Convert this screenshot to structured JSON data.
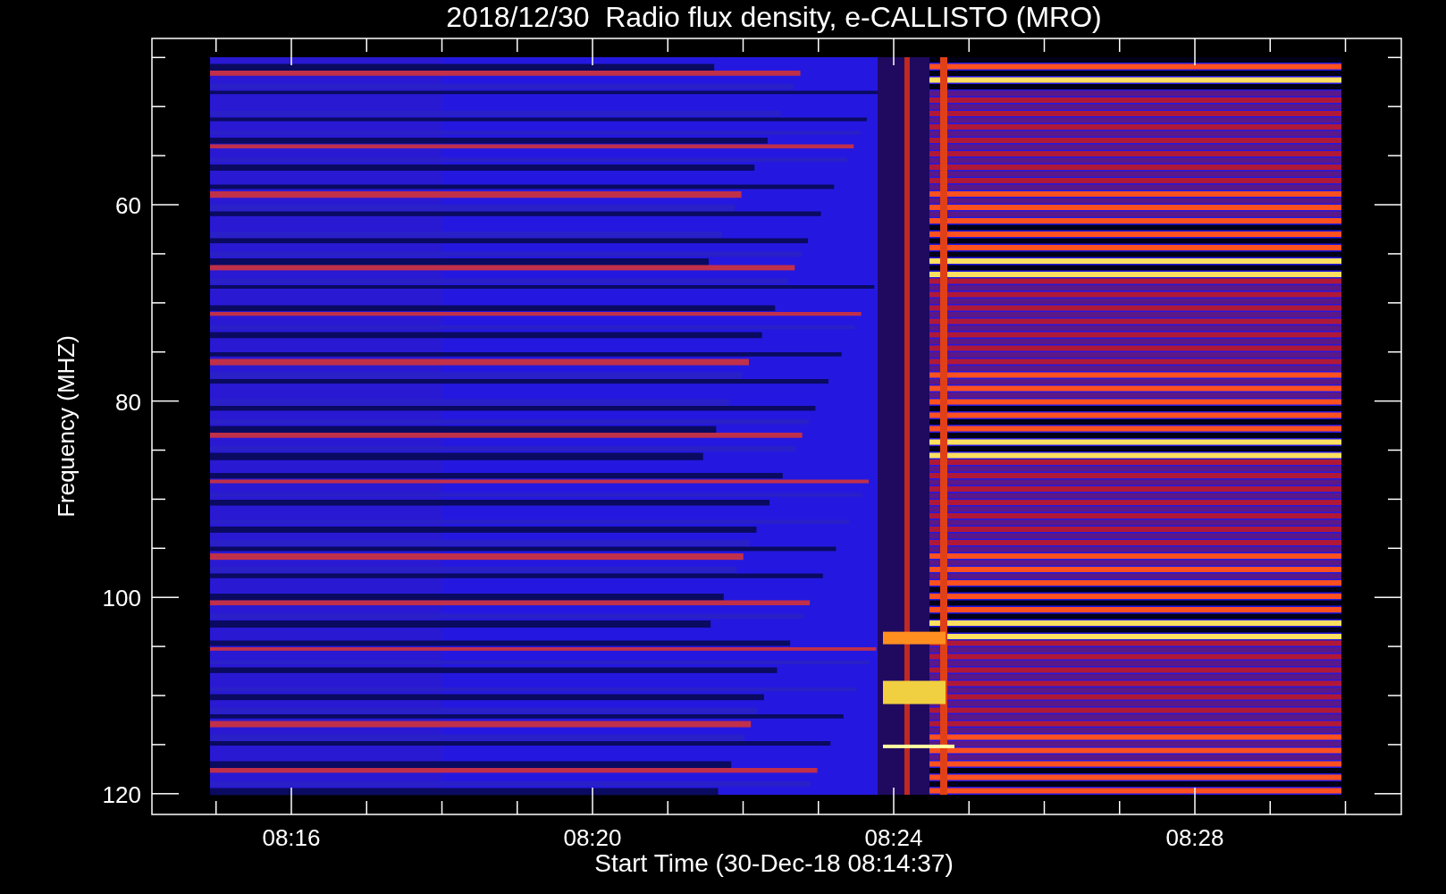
{
  "title": "2018/12/30  Radio flux density, e-CALLISTO (MRO)",
  "plot": {
    "xlabel": "Start Time (30-Dec-18 08:14:37)",
    "ylabel": "Frequency (MHZ)",
    "yticks": [
      "60",
      "80",
      "100",
      "120"
    ],
    "xticks": [
      "08:16",
      "08:20",
      "08:24",
      "08:28"
    ]
  }
}
